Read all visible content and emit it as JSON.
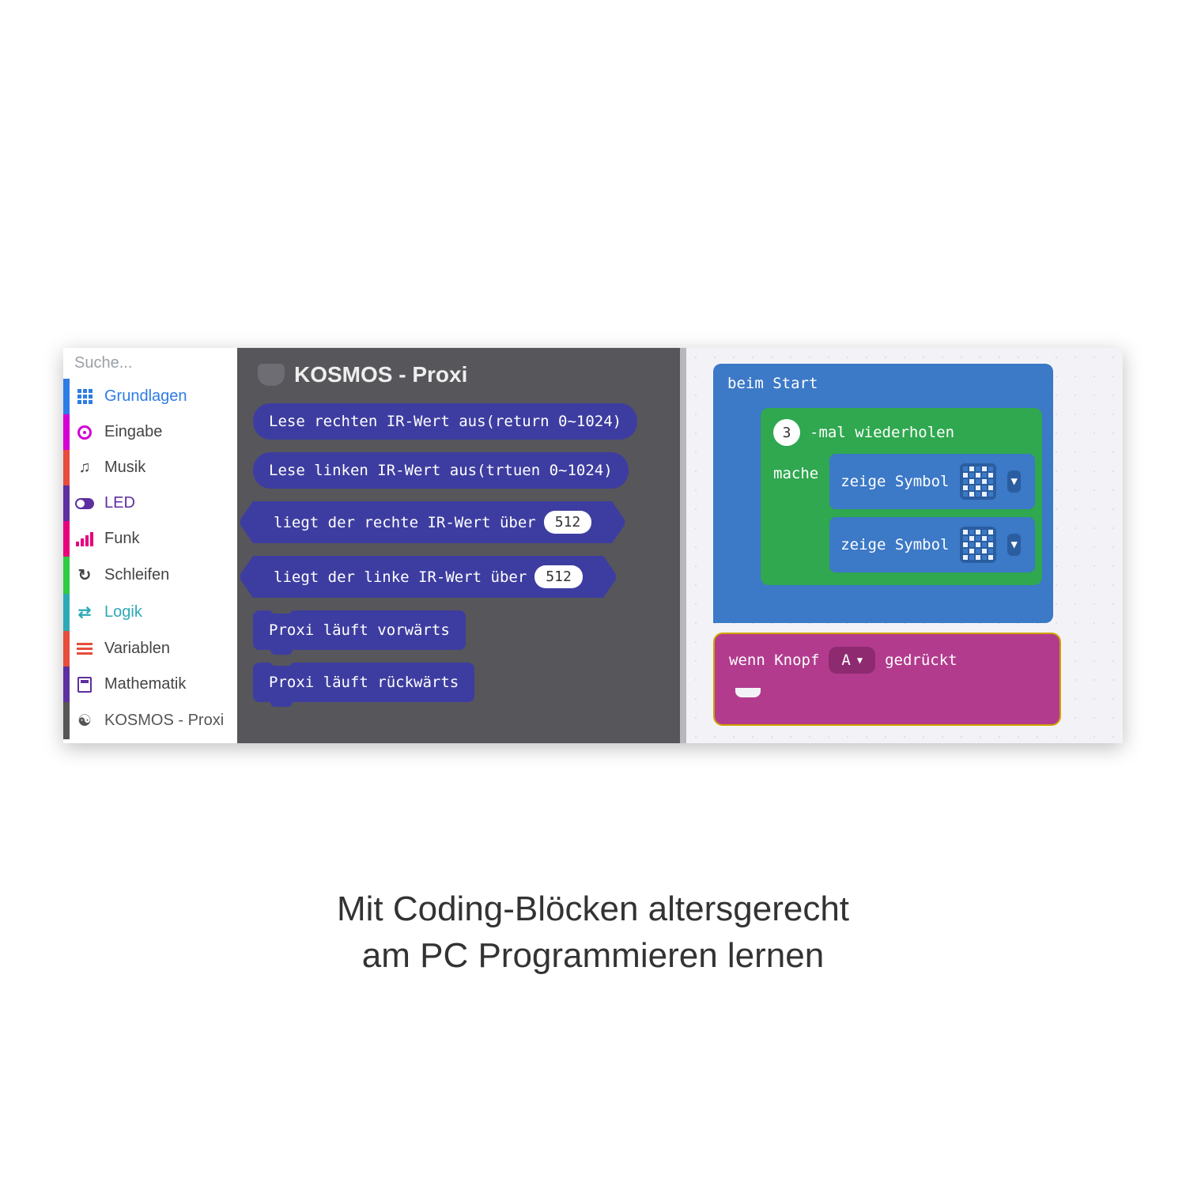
{
  "search": {
    "placeholder": "Suche..."
  },
  "categories": {
    "grundlagen": "Grundlagen",
    "eingabe": "Eingabe",
    "musik": "Musik",
    "led": "LED",
    "funk": "Funk",
    "schleifen": "Schleifen",
    "logik": "Logik",
    "variablen": "Variablen",
    "mathematik": "Mathematik",
    "kosmos": "KOSMOS - Proxi"
  },
  "palette": {
    "title": "KOSMOS - Proxi",
    "blocks": {
      "read_right": "Lese rechten IR-Wert aus(return 0~1024)",
      "read_left": "Lese linken IR-Wert aus(trtuen 0~1024)",
      "cond_right_pre": "liegt der rechte IR-Wert über",
      "cond_right_val": "512",
      "cond_left_pre": "liegt der linke IR-Wert über",
      "cond_left_val": "512",
      "fwd": "Proxi läuft vorwärts",
      "bwd": "Proxi läuft rückwärts"
    }
  },
  "canvas": {
    "start_label": "beim Start",
    "loop_count": "3",
    "loop_suffix": "-mal wiederholen",
    "mache": "mache",
    "show_symbol": "zeige Symbol",
    "event_pre": "wenn Knopf",
    "event_btn": "A",
    "event_post": "gedrückt"
  },
  "caption_line1": "Mit Coding-Blöcken altersgerecht",
  "caption_line2": "am PC Programmieren lernen"
}
